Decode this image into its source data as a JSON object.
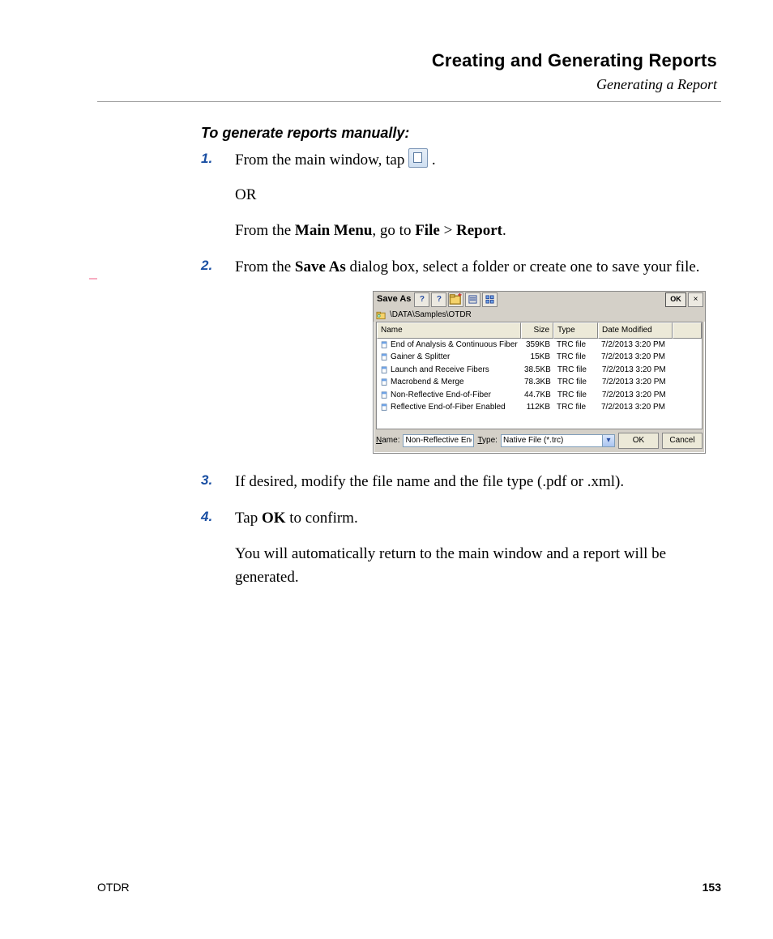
{
  "header": {
    "chapter_title": "Creating and Generating Reports",
    "section_title": "Generating a Report"
  },
  "procedure_title": "To generate reports manually:",
  "steps": {
    "s1": {
      "p1_a": "From the main window, tap ",
      "p1_b": " .",
      "p2": "OR",
      "p3_a": "From the ",
      "p3_main_menu": "Main Menu",
      "p3_b": ", go to ",
      "p3_file": "File",
      "p3_gt": " > ",
      "p3_report": "Report",
      "p3_c": "."
    },
    "s2": {
      "p1_a": "From the ",
      "p1_saveas": "Save As",
      "p1_b": " dialog box, select a folder or create one to save your file."
    },
    "s3": {
      "p1": "If desired, modify the file name and the file type (.pdf or .xml)."
    },
    "s4": {
      "p1_a": "Tap ",
      "p1_ok": "OK",
      "p1_b": " to confirm.",
      "p2": "You will automatically return to the main window and a report will be generated."
    }
  },
  "dialog": {
    "title": "Save As",
    "ok": "OK",
    "close": "×",
    "path": "\\DATA\\Samples\\OTDR",
    "columns": {
      "name": "Name",
      "size": "Size",
      "type": "Type",
      "date": "Date Modified"
    },
    "rows": [
      {
        "name": "End of Analysis & Continuous Fiber",
        "size": "359KB",
        "type": "TRC file",
        "date": "7/2/2013 3:20 PM"
      },
      {
        "name": "Gainer & Splitter",
        "size": "15KB",
        "type": "TRC file",
        "date": "7/2/2013 3:20 PM"
      },
      {
        "name": "Launch and Receive Fibers",
        "size": "38.5KB",
        "type": "TRC file",
        "date": "7/2/2013 3:20 PM"
      },
      {
        "name": "Macrobend & Merge",
        "size": "78.3KB",
        "type": "TRC file",
        "date": "7/2/2013 3:20 PM"
      },
      {
        "name": "Non-Reflective End-of-Fiber",
        "size": "44.7KB",
        "type": "TRC file",
        "date": "7/2/2013 3:20 PM"
      },
      {
        "name": "Reflective End-of-Fiber Enabled",
        "size": "112KB",
        "type": "TRC file",
        "date": "7/2/2013 3:20 PM"
      }
    ],
    "name_label": "Name:",
    "name_value": "Non-Reflective End-",
    "type_label": "Type:",
    "type_value": "Native File (*.trc)",
    "btn_ok": "OK",
    "btn_cancel": "Cancel"
  },
  "footer": {
    "left": "OTDR",
    "right": "153"
  }
}
